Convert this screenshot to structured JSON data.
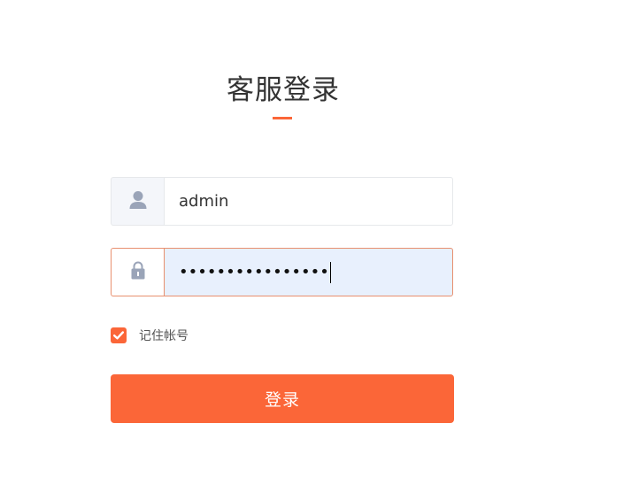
{
  "login": {
    "title": "客服登录",
    "username": {
      "icon": "user-icon",
      "value": "admin"
    },
    "password": {
      "icon": "lock-icon",
      "masked_value": "••••••••••••••••"
    },
    "remember": {
      "label": "记住帐号",
      "checked": true
    },
    "submit_label": "登录"
  },
  "colors": {
    "accent": "#fb6638",
    "input_autofill_bg": "#e8f0fd",
    "icon": "#9aa4b8",
    "text": "#333333"
  }
}
